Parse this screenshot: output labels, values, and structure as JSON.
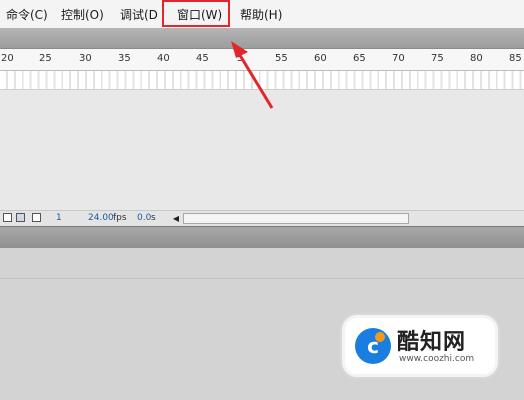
{
  "menu": {
    "items": [
      {
        "label": "命令(C)"
      },
      {
        "label": "控制(O)"
      },
      {
        "label": "调试(D"
      },
      {
        "label": "窗口(W)"
      },
      {
        "label": "帮助(H)"
      }
    ],
    "highlight_color": "#e2262c"
  },
  "ruler": {
    "ticks": [
      "20",
      "25",
      "30",
      "35",
      "40",
      "45",
      "5",
      "55",
      "60",
      "65",
      "70",
      "75",
      "80",
      "85"
    ]
  },
  "status": {
    "frame": "1",
    "fps_value": "24.00",
    "fps_unit": "fps",
    "time_value": "0.0",
    "time_unit": "s",
    "icons": [
      "onion-skin-icon",
      "onion-outline-icon",
      "edit-multiple-frames-icon"
    ]
  },
  "watermark": {
    "logo_letter": "c",
    "name": "酷知网",
    "url": "www.coozhi.com"
  }
}
